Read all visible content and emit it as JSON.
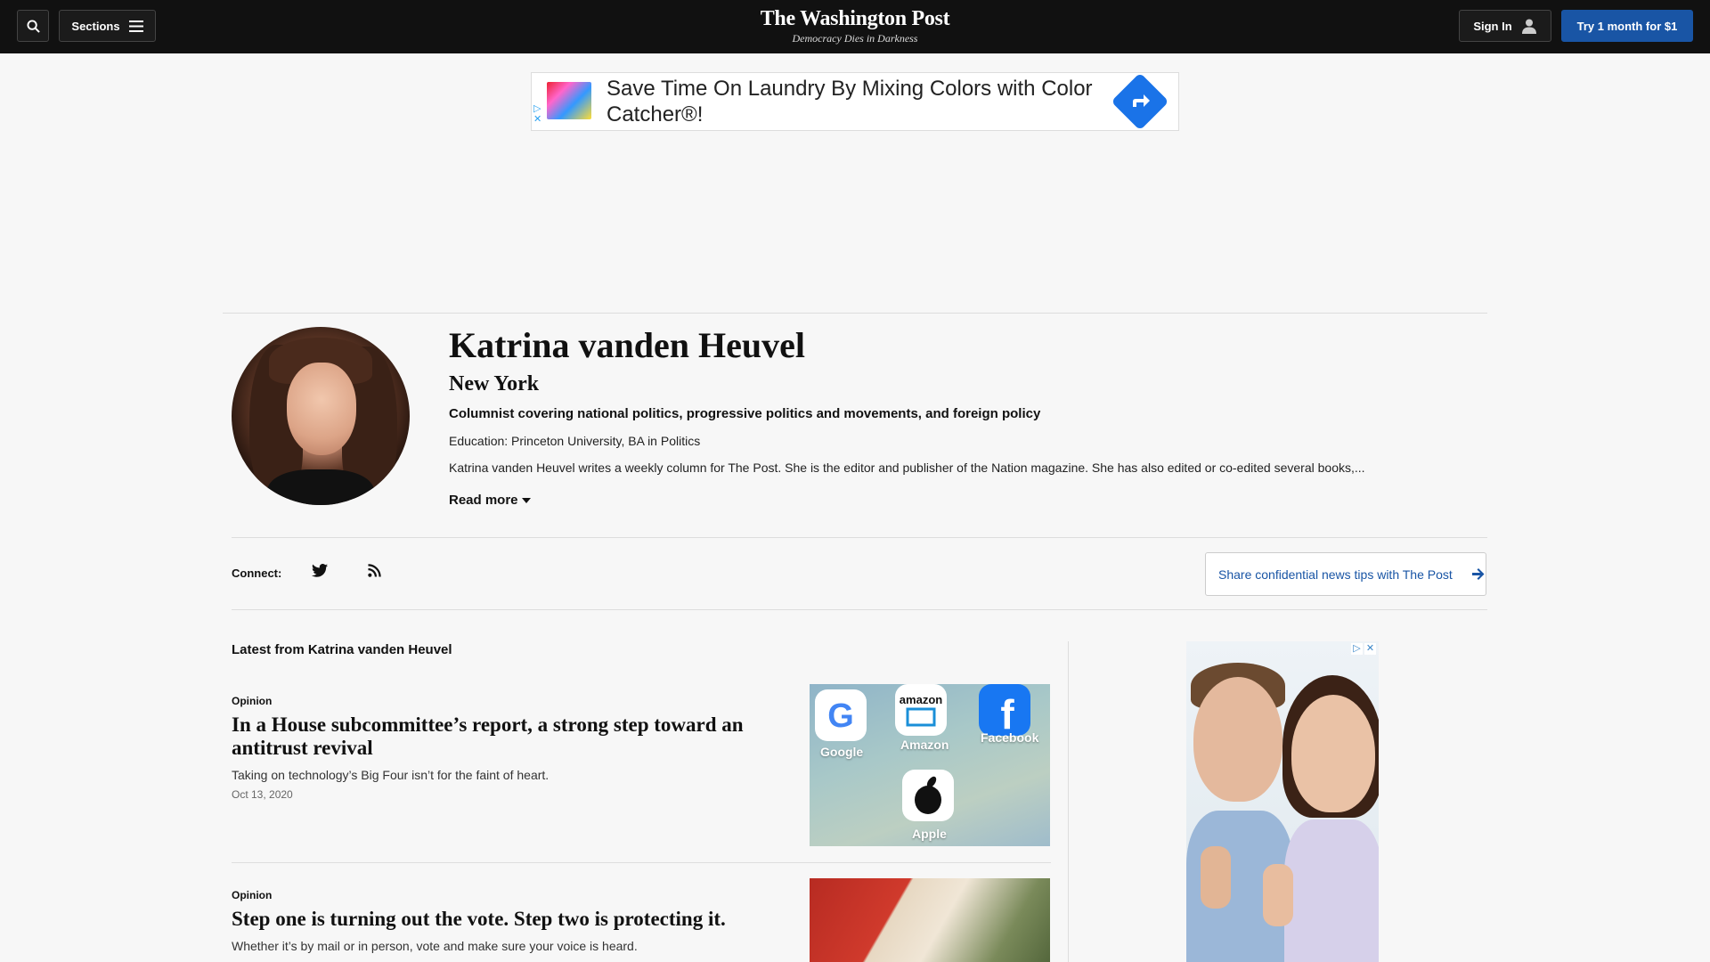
{
  "header": {
    "search_label": "",
    "sections_label": "Sections",
    "logo": "The Washington Post",
    "tagline": "Democracy Dies in Darkness",
    "signin_label": "Sign In",
    "subscribe_label": "Try 1 month for $1"
  },
  "ad_banner": {
    "text": "Save Time On Laundry By Mixing Colors with Color Catcher®!"
  },
  "profile": {
    "name": "Katrina vanden Heuvel",
    "location": "New York",
    "role": "Columnist covering national politics, progressive politics and movements, and foreign policy",
    "education": "Education: Princeton University, BA in Politics",
    "bio": "Katrina vanden Heuvel writes a weekly column for The Post. She is the editor and publisher of the Nation magazine. She has also edited or co-edited several books,...",
    "read_more": "Read more"
  },
  "connect": {
    "label": "Connect:",
    "icons": [
      "twitter-icon",
      "rss-icon"
    ],
    "tips_label": "Share confidential news tips with The Post"
  },
  "latest": {
    "title": "Latest from Katrina vanden Heuvel",
    "stories": [
      {
        "kicker": "Opinion",
        "headline": "In a House subcommittee’s report, a strong step toward an antitrust revival",
        "blurb": "Taking on technology’s Big Four isn’t for the faint of heart.",
        "date": "Oct 13, 2020",
        "thumb_apps": [
          "Google",
          "Amazon",
          "Facebook",
          "Apple"
        ]
      },
      {
        "kicker": "Opinion",
        "headline": "Step one is turning out the vote. Step two is protecting it.",
        "blurb": "Whether it’s by mail or in person, vote and make sure your voice is heard."
      }
    ]
  },
  "colors": {
    "topbar": "#111111",
    "subscribe": "#1955a5",
    "link": "#1955a5"
  }
}
